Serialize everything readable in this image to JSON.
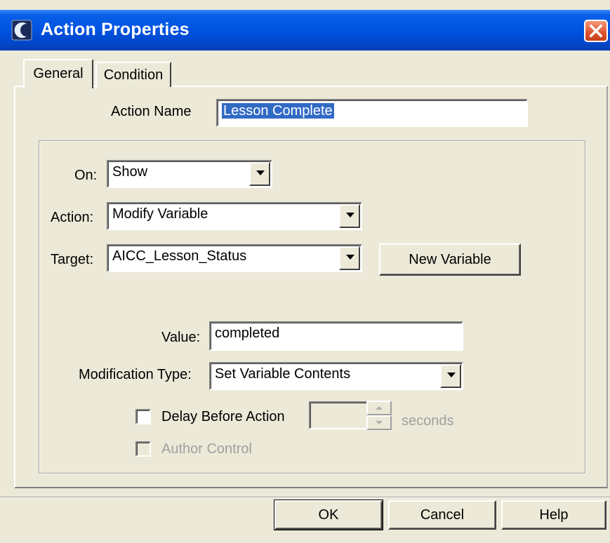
{
  "window": {
    "title": "Action Properties",
    "icon": "app-icon",
    "close_icon": "close-icon"
  },
  "tabs": [
    {
      "label": "General",
      "selected": true
    },
    {
      "label": "Condition",
      "selected": false
    }
  ],
  "general": {
    "action_name_label": "Action Name",
    "action_name_value": "Lesson Complete",
    "on_label": "On:",
    "on_value": "Show",
    "action_label": "Action:",
    "action_value": "Modify Variable",
    "target_label": "Target:",
    "target_value": "AICC_Lesson_Status",
    "new_variable_label": "New Variable",
    "value_label": "Value:",
    "value_value": "completed",
    "modtype_label": "Modification Type:",
    "modtype_value": "Set Variable Contents",
    "delay_label": "Delay Before Action",
    "delay_value": "",
    "seconds_label": "seconds",
    "author_control_label": "Author Control"
  },
  "buttons": {
    "ok": "OK",
    "cancel": "Cancel",
    "help": "Help"
  },
  "colors": {
    "titlebar": "#0054e3",
    "face": "#ece9d8",
    "selection": "#316ac5",
    "close": "#e0542d"
  }
}
